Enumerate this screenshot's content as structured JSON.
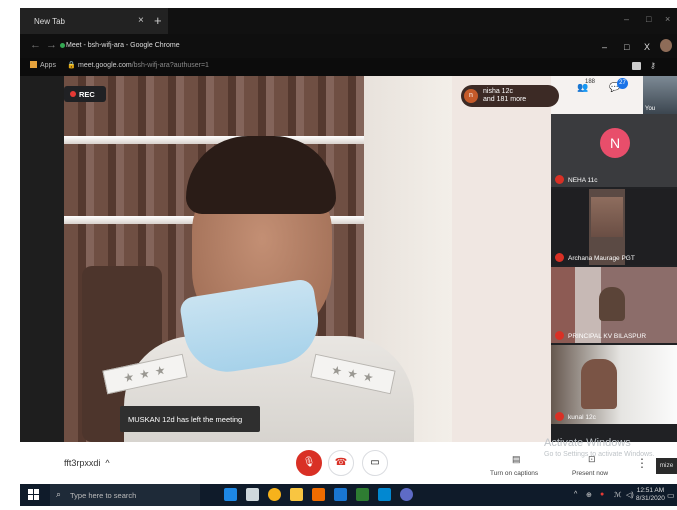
{
  "browser": {
    "tab_title": "New Tab",
    "tab_close": "×",
    "new_tab": "+",
    "window_title": "Meet - bsh-wifj-ara - Google Chrome",
    "url_host": "meet.google.com",
    "url_path": "/bsh-wifj-ara?authuser=1",
    "apps_label": "Apps",
    "nav_back": "←",
    "nav_forward": "→",
    "win_min": "–",
    "win_max": "□",
    "win_close": "X"
  },
  "meet": {
    "rec_label": "REC",
    "presenter_chip": {
      "initial": "n",
      "line1": "nisha 12c",
      "line2": "and 181 more"
    },
    "participants_count": "188",
    "chat_count": "27",
    "you_label": "You",
    "toast": "MUSKAN 12d has left the meeting",
    "tiles": [
      {
        "label": "NEHA 11c",
        "avatar": "N"
      },
      {
        "label": "Archana Maurage PGT"
      },
      {
        "label": "PRINCIPAL KV BILASPUR"
      },
      {
        "label": "kunal 12c"
      }
    ],
    "meeting_code": "fft3rpxxdi",
    "caret": "^",
    "captions_label": "Turn on captions",
    "present_label": "Present now",
    "more_icon": "⋮",
    "watermark_title": "Activate Windows",
    "watermark_sub": "Go to Settings to activate Windows.",
    "cropped_text": "mize"
  },
  "taskbar": {
    "search_placeholder": "Type here to search",
    "time": "12:51 AM",
    "date": "8/31/2020"
  },
  "colors": {
    "rec_red": "#e53935",
    "mute_red": "#d93025",
    "google_blue": "#1a73e8",
    "taskbar": "#0f1b2a"
  }
}
